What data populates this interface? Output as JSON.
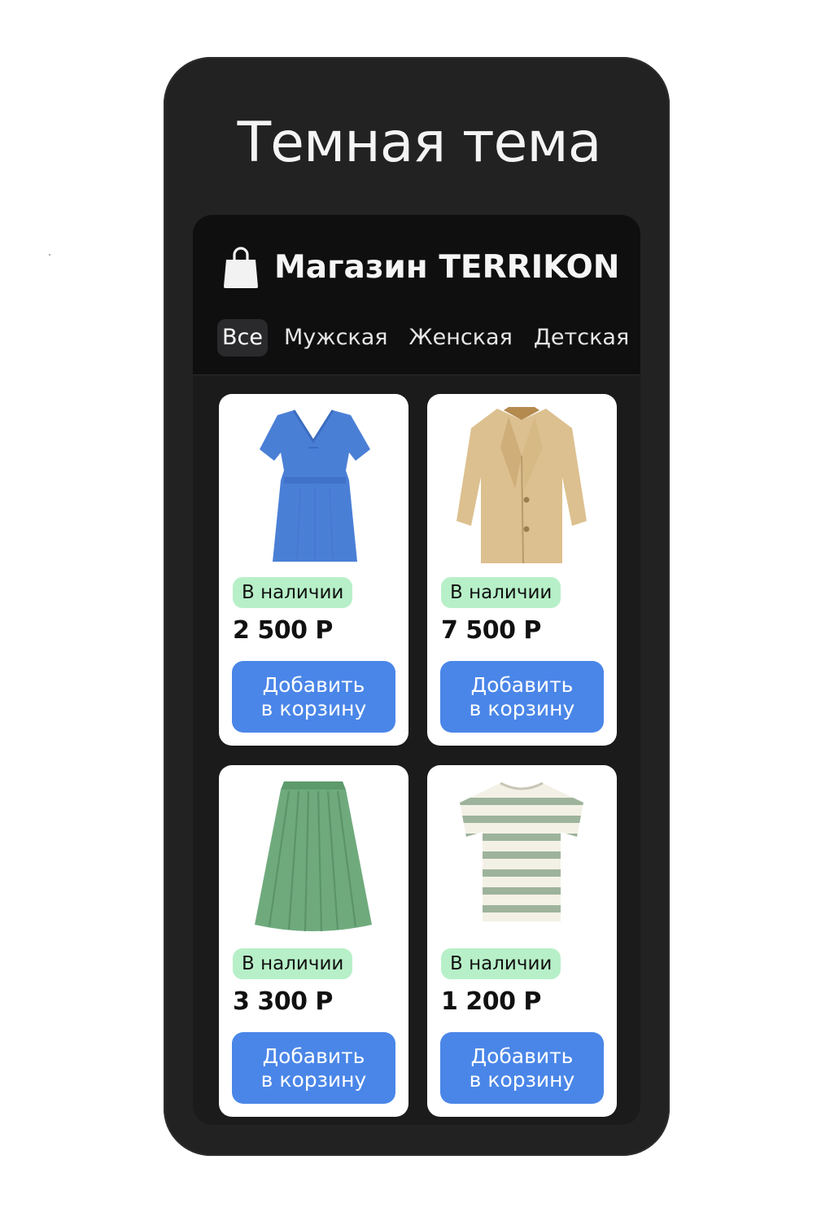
{
  "page": {
    "title": "Темная тема"
  },
  "store": {
    "icon": "shopping-bag-icon",
    "name": "Магазин TERRIKON"
  },
  "tabs": [
    {
      "label": "Все",
      "active": true
    },
    {
      "label": "Мужская",
      "active": false
    },
    {
      "label": "Женская",
      "active": false
    },
    {
      "label": "Детская",
      "active": false
    }
  ],
  "products": [
    {
      "image": "blue-dress-image",
      "status": "В наличии",
      "price": "2 500 Р",
      "button_line1": "Добавить",
      "button_line2": "в корзину"
    },
    {
      "image": "beige-coat-image",
      "status": "В наличии",
      "price": "7 500 Р",
      "button_line1": "Добавить",
      "button_line2": "в корзину"
    },
    {
      "image": "green-skirt-image",
      "status": "В наличии",
      "price": "3 300 Р",
      "button_line1": "Добавить",
      "button_line2": "в корзину"
    },
    {
      "image": "striped-tshirt-image",
      "status": "В наличии",
      "price": "1 200 Р",
      "button_line1": "Добавить",
      "button_line2": "в корзину"
    }
  ],
  "colors": {
    "phone_body": "#222223",
    "topbar": "#0f0f10",
    "badge_bg": "#b7f0c8",
    "button_bg": "#4a86e8",
    "card_bg": "#ffffff"
  }
}
